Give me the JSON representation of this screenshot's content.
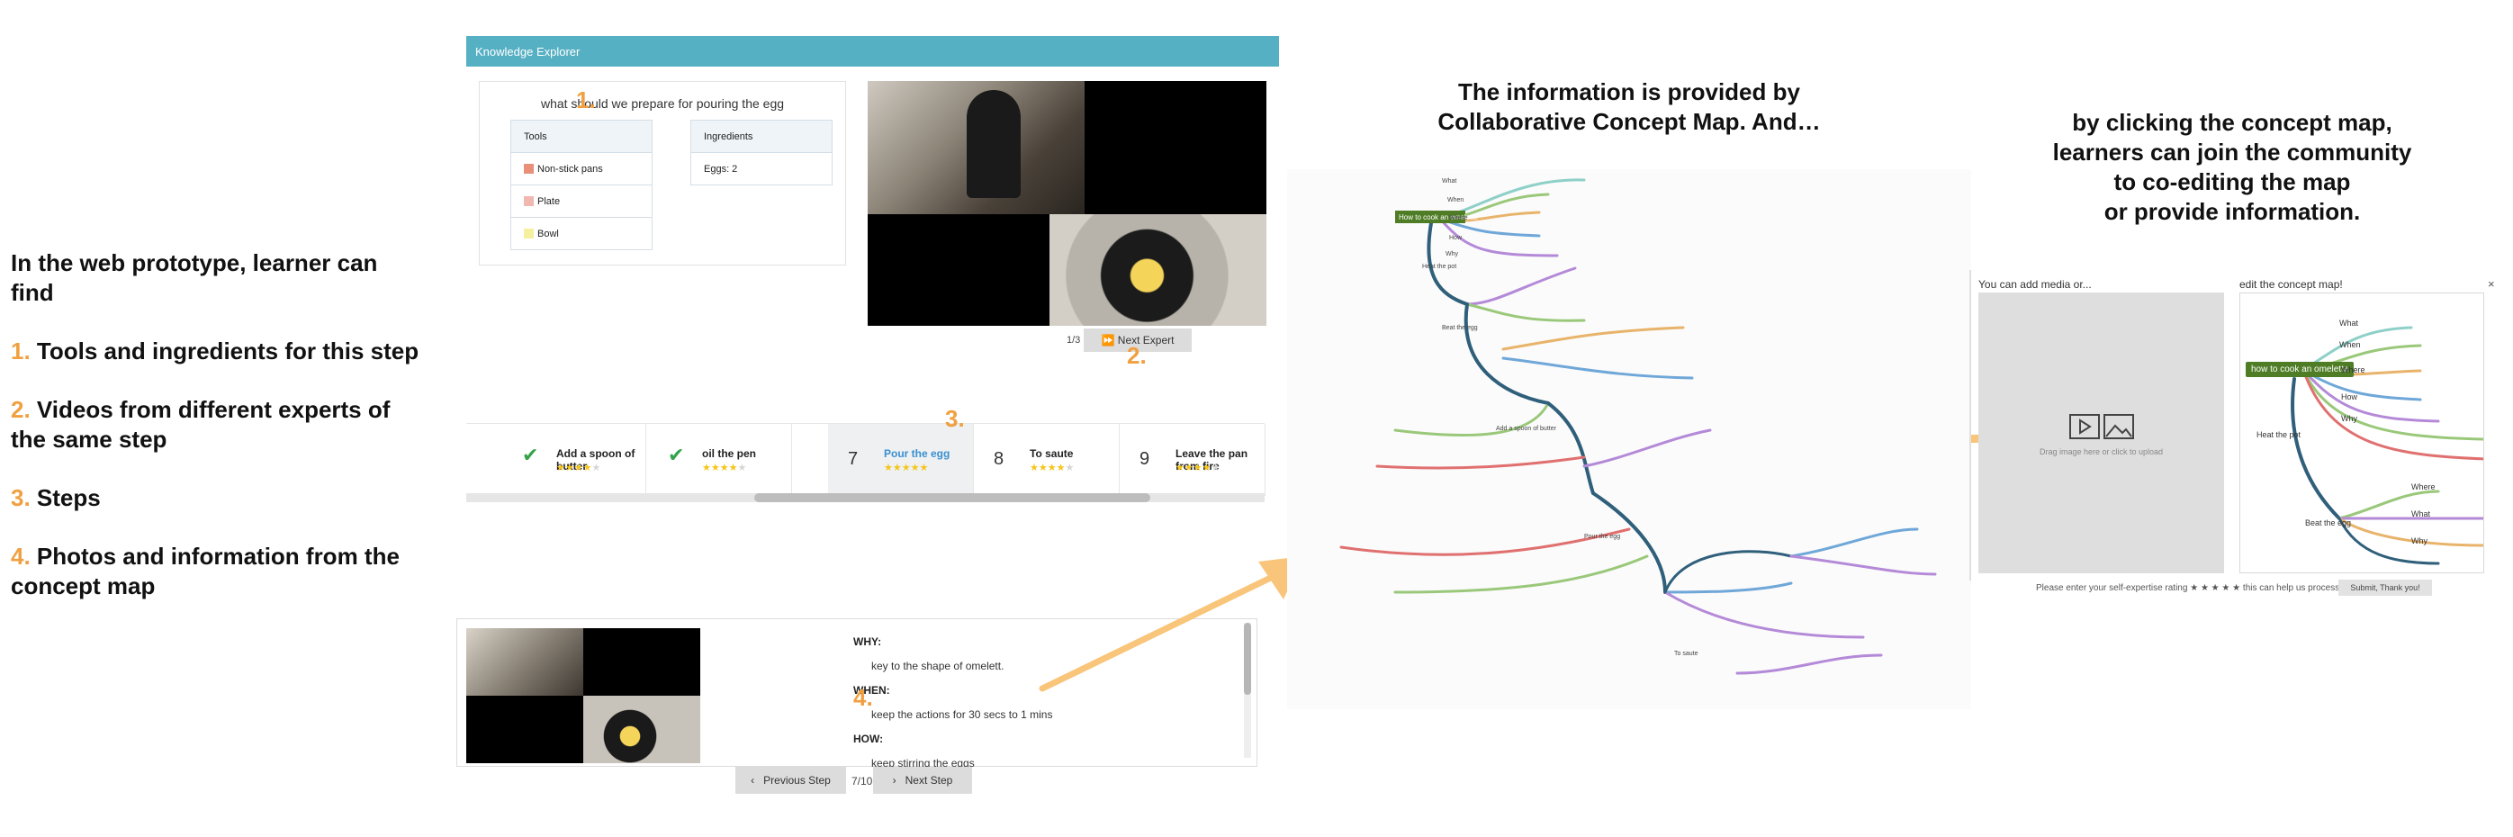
{
  "left_notes": {
    "intro": "In the web prototype, learner can find",
    "items": [
      {
        "num": "1.",
        "text": "Tools and ingredients for this step"
      },
      {
        "num": "2.",
        "text": "Videos from different experts of the same step"
      },
      {
        "num": "3.",
        "text": "Steps"
      },
      {
        "num": "4.",
        "text": "Photos and information from the concept map"
      }
    ]
  },
  "explorer": {
    "header": "Knowledge Explorer",
    "question": "what should we prepare for pouring the egg",
    "tools_header": "Tools",
    "tools": [
      "Non-stick pans",
      "Plate",
      "Bowl"
    ],
    "ingredients_header": "Ingredients",
    "ingredients": [
      "Eggs: 2"
    ],
    "expert_count": "1/3",
    "next_expert": "Next Expert",
    "steps": [
      {
        "num": "",
        "label": "Add a spoon of butter",
        "done": true,
        "stars": 4
      },
      {
        "num": "",
        "label": "oil the pen",
        "done": true,
        "stars": 4
      },
      {
        "num": "7",
        "label": "Pour the egg",
        "done": false,
        "stars": 5,
        "active": true
      },
      {
        "num": "8",
        "label": "To saute",
        "done": false,
        "stars": 4
      },
      {
        "num": "9",
        "label": "Leave the pan from fire",
        "done": false,
        "stars": 4
      }
    ],
    "info": {
      "why_label": "WHY:",
      "why": "key to the shape of omelett.",
      "when_label": "WHEN:",
      "when": "keep the actions for 30 secs to 1 mins",
      "how_label": "HOW:",
      "how": "keep stirring the eggs"
    },
    "prev_step": "Previous Step",
    "page_count": "7/10",
    "next_step": "Next Step"
  },
  "markers": {
    "m1": "1.",
    "m2": "2.",
    "m3": "3.",
    "m4": "4."
  },
  "concept_map": {
    "caption_line1": "The information is provided by",
    "caption_line2": "Collaborative Concept Map. And…",
    "root": "How to cook an omelette",
    "branch_labels": [
      "What",
      "When",
      "Where",
      "How",
      "Why",
      "Heat the pot",
      "Beat the egg",
      "Add a spoon of butter",
      "Pour the egg",
      "To saute"
    ]
  },
  "right_caption": {
    "line1": "by clicking the concept map,",
    "line2": "learners can join the community",
    "line3": "to co-editing the map",
    "line4": "or provide information."
  },
  "edit_panel": {
    "media_title": "You can add media or...",
    "media_hint": "Drag image here or click to upload",
    "edit_title": "edit the concept map!",
    "close": "×",
    "root": "how to cook an omelette",
    "labels": [
      "What",
      "When",
      "Where",
      "How",
      "Why",
      "Heat the pot",
      "Beat the egg",
      "Where",
      "What",
      "Why"
    ],
    "rating_text": "Please enter your self-expertise rating ★ ★ ★ ★ ★ this can help us process your data!",
    "submit": "Submit, Thank you!"
  },
  "colors": {
    "header": "#56b0c3",
    "marker": "#f0a040",
    "check": "#33a34a",
    "star": "#f5c518",
    "node": "#4f7d26"
  }
}
